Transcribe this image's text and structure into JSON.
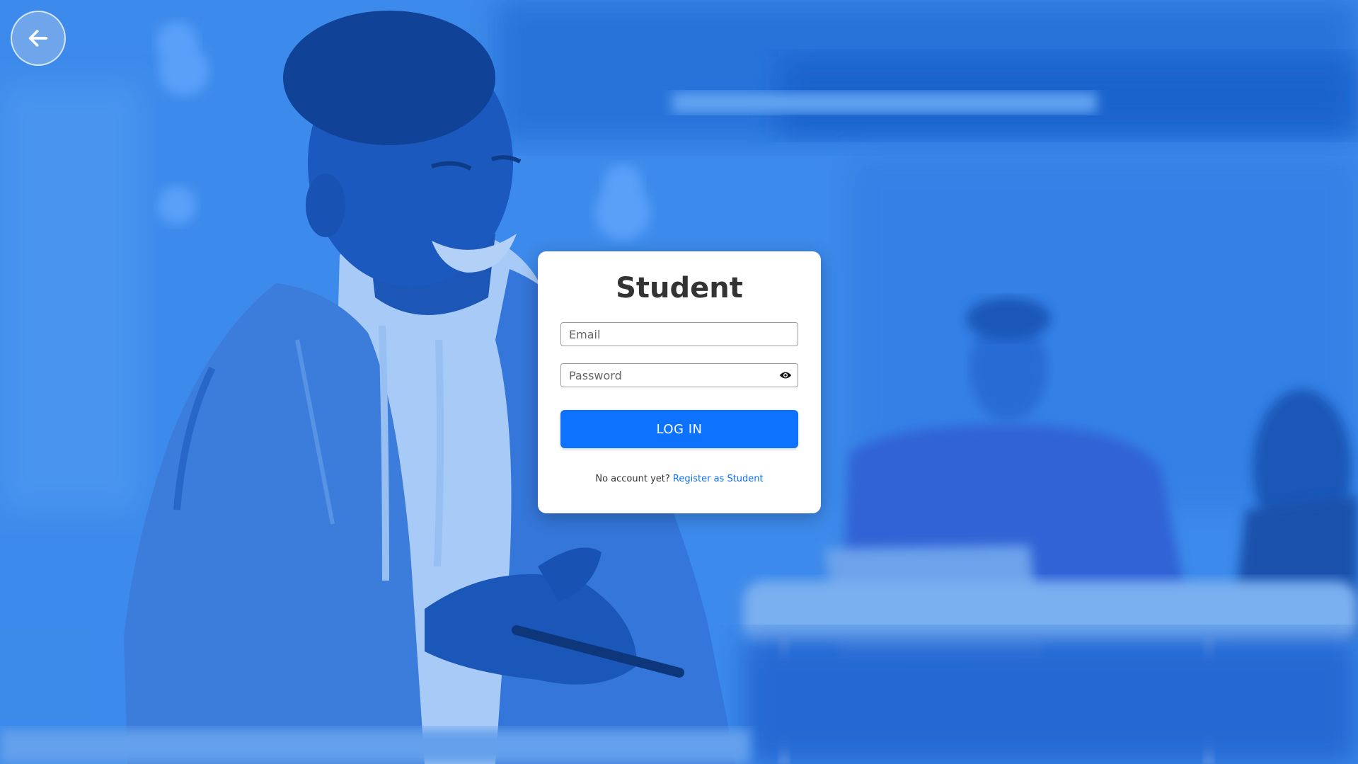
{
  "background": {
    "description_icon": "classroom-photo"
  },
  "nav": {
    "back_icon": "arrow-left-icon"
  },
  "login": {
    "title": "Student",
    "email_placeholder": "Email",
    "email_value": "",
    "password_placeholder": "Password",
    "password_value": "",
    "password_toggle_icon": "eye-icon",
    "submit_label": "LOG IN",
    "footer_text": "No account yet?",
    "register_link_label": "Register as Student"
  },
  "colors": {
    "primary": "#0d73ff",
    "link": "#0d6efd",
    "title": "#333333",
    "background_tint": "#3d8ae8"
  }
}
